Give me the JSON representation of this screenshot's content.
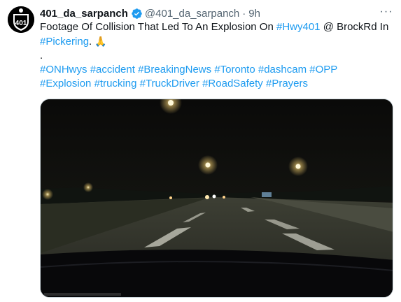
{
  "tweet": {
    "author_name": "401_da_sarpanch",
    "handle": "@401_da_sarpanch",
    "separator": "·",
    "time": "9h",
    "more_label": "···",
    "text_line1_a": "Footage Of Collision That Led To An Explosion On ",
    "hashtag_hwy401": "#Hwy401",
    "text_line1_b": " @ BrockRd In",
    "hashtag_pickering": "#Pickering",
    "text_line2_b": ".",
    "emoji_pray": "🙏",
    "text_line3": ".",
    "hashtags": [
      "#ONHwys",
      "#accident",
      "#BreakingNews",
      "#Toronto",
      "#dashcam",
      "#OPP",
      "#Explosion",
      "#trucking",
      "#TruckDriver",
      "#RoadSafety",
      "#Prayers"
    ]
  },
  "avatar": {
    "shield_text": "401"
  },
  "icons": {
    "verified": "verified-badge-icon",
    "more": "more-options-icon",
    "avatar": "hwy-401-shield-icon"
  },
  "colors": {
    "link": "#1d9bf0",
    "verified": "#1d9bf0",
    "secondary_text": "#536471"
  }
}
